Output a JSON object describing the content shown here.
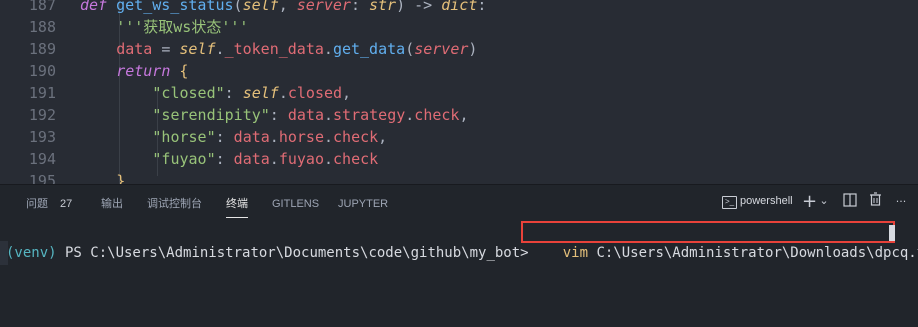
{
  "editor": {
    "lines": [
      {
        "num": "187",
        "tokens": [
          [
            "kw",
            "def "
          ],
          [
            "fn",
            "get_ws_status"
          ],
          [
            "plain",
            "("
          ],
          [
            "self",
            "self"
          ],
          [
            "plain",
            ", "
          ],
          [
            "param",
            "server"
          ],
          [
            "plain",
            ": "
          ],
          [
            "self",
            "str"
          ],
          [
            "plain",
            ") -> "
          ],
          [
            "self",
            "dict"
          ],
          [
            "plain",
            ":"
          ]
        ]
      },
      {
        "num": "188",
        "tokens": [
          [
            "str",
            "'''获取ws状态'''"
          ]
        ]
      },
      {
        "num": "189",
        "tokens": [
          [
            "attr",
            "data"
          ],
          [
            "plain",
            " = "
          ],
          [
            "self",
            "self"
          ],
          [
            "plain",
            "."
          ],
          [
            "attr",
            "_token_data"
          ],
          [
            "plain",
            "."
          ],
          [
            "fn",
            "get_data"
          ],
          [
            "plain",
            "("
          ],
          [
            "param",
            "server"
          ],
          [
            "plain",
            ")"
          ]
        ]
      },
      {
        "num": "190",
        "tokens": [
          [
            "kw",
            "return"
          ],
          [
            "plain",
            " "
          ],
          [
            "bracket",
            "{"
          ]
        ]
      },
      {
        "num": "191",
        "tokens": [
          [
            "str",
            "\"closed\""
          ],
          [
            "plain",
            ": "
          ],
          [
            "self",
            "self"
          ],
          [
            "plain",
            "."
          ],
          [
            "attr",
            "closed"
          ],
          [
            "plain",
            ","
          ]
        ]
      },
      {
        "num": "192",
        "tokens": [
          [
            "str",
            "\"serendipity\""
          ],
          [
            "plain",
            ": "
          ],
          [
            "attr",
            "data"
          ],
          [
            "plain",
            "."
          ],
          [
            "attr",
            "strategy"
          ],
          [
            "plain",
            "."
          ],
          [
            "attr",
            "check"
          ],
          [
            "plain",
            ","
          ]
        ]
      },
      {
        "num": "193",
        "tokens": [
          [
            "str",
            "\"horse\""
          ],
          [
            "plain",
            ": "
          ],
          [
            "attr",
            "data"
          ],
          [
            "plain",
            "."
          ],
          [
            "attr",
            "horse"
          ],
          [
            "plain",
            "."
          ],
          [
            "attr",
            "check"
          ],
          [
            "plain",
            ","
          ]
        ]
      },
      {
        "num": "194",
        "tokens": [
          [
            "str",
            "\"fuyao\""
          ],
          [
            "plain",
            ": "
          ],
          [
            "attr",
            "data"
          ],
          [
            "plain",
            "."
          ],
          [
            "attr",
            "fuyao"
          ],
          [
            "plain",
            "."
          ],
          [
            "attr",
            "check"
          ]
        ]
      },
      {
        "num": "195",
        "tokens": [
          [
            "bracket",
            "}"
          ]
        ]
      }
    ]
  },
  "panel": {
    "tabs": [
      {
        "label": "问题",
        "badge": "27",
        "active": false
      },
      {
        "label": "输出",
        "active": false
      },
      {
        "label": "调试控制台",
        "active": false
      },
      {
        "label": "终端",
        "active": true
      },
      {
        "label": "GITLENS",
        "active": false
      },
      {
        "label": "JUPYTER",
        "active": false
      }
    ],
    "terminal_name": "powershell",
    "actions": {
      "add": "+",
      "dropdown": "⌄",
      "split": "◫",
      "trash": "🗑",
      "more": "···",
      "maximize": "⌃",
      "close": "✕"
    }
  },
  "terminal": {
    "venv": "(venv)",
    "prompt": " PS C:\\Users\\Administrator\\Documents\\code\\github\\my_bot> ",
    "command_keyword": "vim",
    "command_arg": " C:\\Users\\Administrator\\Downloads\\dpcq.txt"
  },
  "colors": {
    "highlight_box": "#e8423a"
  }
}
